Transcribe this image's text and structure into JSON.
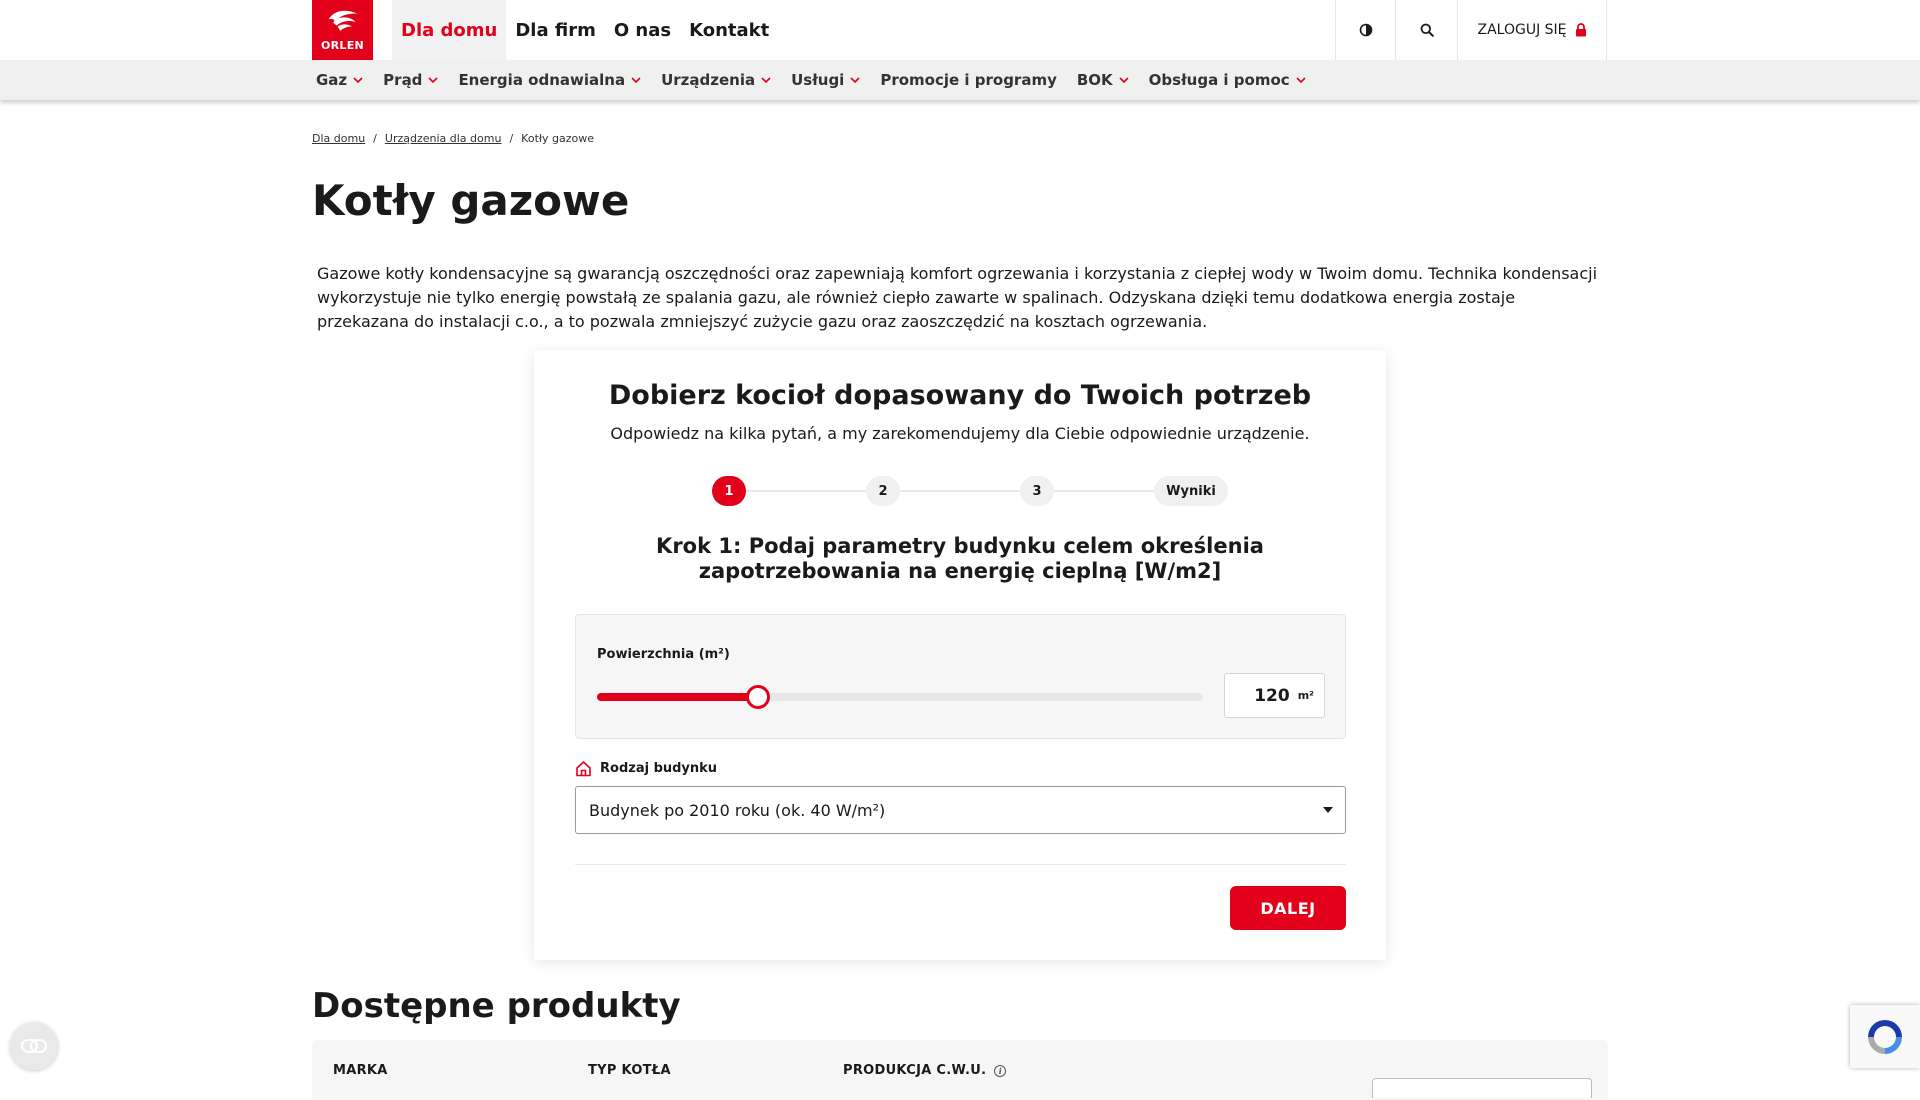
{
  "header": {
    "logo_text": "ORLEN",
    "main_nav": [
      {
        "label": "Dla domu",
        "active": true
      },
      {
        "label": "Dla firm",
        "active": false
      },
      {
        "label": "O nas",
        "active": false
      },
      {
        "label": "Kontakt",
        "active": false
      }
    ],
    "login_label": "ZALOGUJ SIĘ",
    "icons": {
      "contrast": "contrast-icon",
      "search": "search-icon",
      "lock": "lock-icon"
    }
  },
  "subnav": [
    {
      "label": "Gaz",
      "has_dropdown": true
    },
    {
      "label": "Prąd",
      "has_dropdown": true
    },
    {
      "label": "Energia odnawialna",
      "has_dropdown": true
    },
    {
      "label": "Urządzenia",
      "has_dropdown": true
    },
    {
      "label": "Usługi",
      "has_dropdown": true
    },
    {
      "label": "Promocje i programy",
      "has_dropdown": false
    },
    {
      "label": "BOK",
      "has_dropdown": true
    },
    {
      "label": "Obsługa i pomoc",
      "has_dropdown": true
    }
  ],
  "breadcrumb": {
    "items": [
      "Dla domu",
      "Urządzenia dla domu"
    ],
    "current": "Kotły gazowe"
  },
  "page": {
    "title": "Kotły gazowe",
    "intro": "Gazowe kotły kondensacyjne są gwarancją oszczędności oraz zapewniają komfort ogrzewania i korzystania z ciepłej wody w Twoim domu. Technika kondensacji wykorzystuje nie tylko energię powstałą ze spalania gazu, ale również ciepło zawarte w spalinach. Odzyskana dzięki temu dodatkowa energia zostaje przekazana do instalacji c.o., a to pozwala zmniejszyć zużycie gazu oraz zaoszczędzić na kosztach ogrzewania."
  },
  "wizard": {
    "title": "Dobierz kocioł dopasowany do Twoich potrzeb",
    "subtitle": "Odpowiedz na kilka pytań, a my zarekomendujemy dla Ciebie odpowiednie urządzenie.",
    "steps": [
      "1",
      "2",
      "3",
      "Wyniki"
    ],
    "active_step": 1,
    "step_heading_line1": "Krok 1: Podaj parametry budynku celem określenia",
    "step_heading_line2": "zapotrzebowania na energię cieplną [W/m2]",
    "area_label": "Powierzchnia (m²)",
    "area_value": "120",
    "area_unit": "m²",
    "slider_fraction": 0.265,
    "building_type_label": "Rodzaj budynku",
    "building_type_value": "Budynek po 2010 roku (ok. 40 W/m²)",
    "next_label": "DALEJ"
  },
  "products": {
    "title": "Dostępne produkty",
    "columns": [
      "MARKA",
      "TYP KOTŁA",
      "PRODUKCJA C.W.U."
    ]
  },
  "colors": {
    "brand_red": "#e2001a",
    "subnav_bg": "#f0f0f0",
    "text": "#1a1a1a"
  }
}
